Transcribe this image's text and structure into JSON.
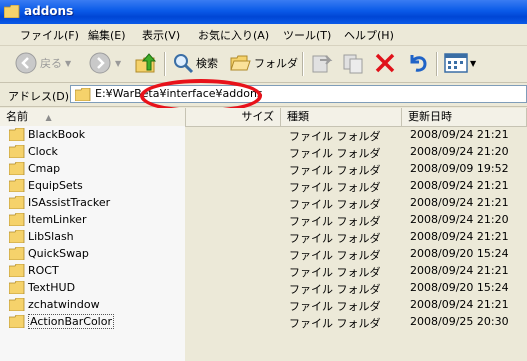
{
  "window": {
    "title": "addons"
  },
  "menu": [
    {
      "label": "ファイル(F)"
    },
    {
      "label": "編集(E)"
    },
    {
      "label": "表示(V)"
    },
    {
      "label": "お気に入り(A)"
    },
    {
      "label": "ツール(T)"
    },
    {
      "label": "ヘルプ(H)"
    }
  ],
  "toolbar": {
    "back_label": "戻る",
    "search_label": "検索",
    "folders_label": "フォルダ"
  },
  "address": {
    "label": "アドレス(D)",
    "value": "E:¥WarBeta¥interface¥addons"
  },
  "columns": {
    "name": "名前",
    "size": "サイズ",
    "type": "種類",
    "date": "更新日時"
  },
  "files": [
    {
      "name": "BlackBook",
      "type": "ファイル フォルダ",
      "date": "2008/09/24 21:21"
    },
    {
      "name": "Clock",
      "type": "ファイル フォルダ",
      "date": "2008/09/24 21:20"
    },
    {
      "name": "Cmap",
      "type": "ファイル フォルダ",
      "date": "2008/09/09 19:52"
    },
    {
      "name": "EquipSets",
      "type": "ファイル フォルダ",
      "date": "2008/09/24 21:21"
    },
    {
      "name": "ISAssistTracker",
      "type": "ファイル フォルダ",
      "date": "2008/09/24 21:21"
    },
    {
      "name": "ItemLinker",
      "type": "ファイル フォルダ",
      "date": "2008/09/24 21:20"
    },
    {
      "name": "LibSlash",
      "type": "ファイル フォルダ",
      "date": "2008/09/24 21:21"
    },
    {
      "name": "QuickSwap",
      "type": "ファイル フォルダ",
      "date": "2008/09/20 15:24"
    },
    {
      "name": "ROCT",
      "type": "ファイル フォルダ",
      "date": "2008/09/24 21:21"
    },
    {
      "name": "TextHUD",
      "type": "ファイル フォルダ",
      "date": "2008/09/20 15:24"
    },
    {
      "name": "zchatwindow",
      "type": "ファイル フォルダ",
      "date": "2008/09/24 21:21"
    },
    {
      "name": "ActionBarColor",
      "type": "ファイル フォルダ",
      "date": "2008/09/25 20:30"
    }
  ],
  "colors": {
    "titlebar": "#0a5ae8",
    "highlight": "#e8121a",
    "folder": "#f5d26b"
  }
}
